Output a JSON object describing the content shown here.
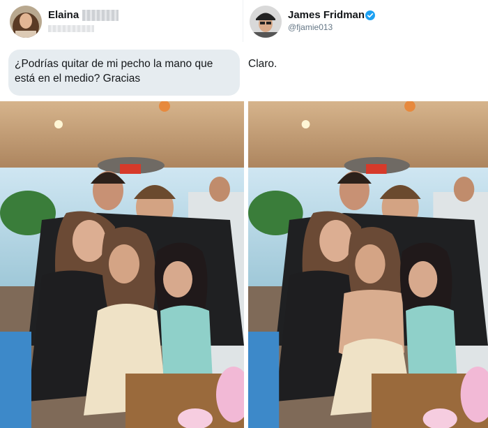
{
  "left_tweet": {
    "author_name": "Elaina",
    "author_avatar": "profile-photo-woman",
    "redacted_surname": "pixelated",
    "redacted_handle": "pixelated",
    "message": "¿Podrías quitar de mi pecho la mano que está en el medio? Gracias"
  },
  "right_tweet": {
    "author_name": "James Fridman",
    "author_handle": "@fjamie013",
    "author_avatar": "profile-photo-man-cap",
    "verified_icon": "verified-badge-icon",
    "reply": "Claro."
  },
  "photos": {
    "original": "group-photo-original",
    "edited": "group-photo-edited"
  },
  "colors": {
    "bubble_bg": "#e6ecf0",
    "verified_blue": "#1da1f2",
    "handle_gray": "#657786",
    "text_dark": "#14171a"
  }
}
